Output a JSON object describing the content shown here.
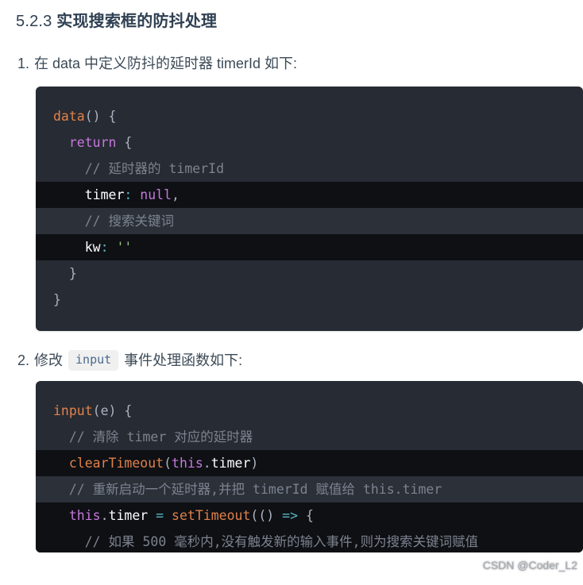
{
  "heading": {
    "number": "5.2.3",
    "title": "实现搜索框的防抖处理",
    "full": "5.2.3 实现搜索框的防抖处理"
  },
  "steps": [
    {
      "marker": "1.",
      "text_before": "在 data 中定义防抖的延时器 timerId 如下:",
      "inline_code": null,
      "text_after": null
    },
    {
      "marker": "2.",
      "text_before": "修改",
      "inline_code": "input",
      "text_after": "事件处理函数如下:"
    }
  ],
  "code_block_1": {
    "language": "javascript",
    "lines": [
      {
        "highlight": "none",
        "tokens": [
          {
            "t": "data",
            "c": "fn"
          },
          {
            "t": "() {",
            "c": "punc"
          }
        ]
      },
      {
        "highlight": "none",
        "tokens": [
          {
            "t": "  ",
            "c": "punc"
          },
          {
            "t": "return",
            "c": "kw"
          },
          {
            "t": " {",
            "c": "punc"
          }
        ]
      },
      {
        "highlight": "none",
        "tokens": [
          {
            "t": "    // 延时器的 timerId",
            "c": "comment"
          }
        ]
      },
      {
        "highlight": "dark",
        "tokens": [
          {
            "t": "    ",
            "c": "punc"
          },
          {
            "t": "timer",
            "c": "prop"
          },
          {
            "t": ":",
            "c": "colon"
          },
          {
            "t": " ",
            "c": "punc"
          },
          {
            "t": "null",
            "c": "null"
          },
          {
            "t": ",",
            "c": "punc"
          }
        ]
      },
      {
        "highlight": "slate",
        "tokens": [
          {
            "t": "    // 搜索关键词",
            "c": "comment"
          }
        ]
      },
      {
        "highlight": "dark",
        "tokens": [
          {
            "t": "    ",
            "c": "punc"
          },
          {
            "t": "kw",
            "c": "prop"
          },
          {
            "t": ":",
            "c": "colon"
          },
          {
            "t": " ",
            "c": "punc"
          },
          {
            "t": "''",
            "c": "str"
          }
        ]
      },
      {
        "highlight": "none",
        "tokens": [
          {
            "t": "  }",
            "c": "punc"
          }
        ]
      },
      {
        "highlight": "none",
        "tokens": [
          {
            "t": "}",
            "c": "punc"
          }
        ]
      }
    ]
  },
  "code_block_2": {
    "language": "javascript",
    "lines": [
      {
        "highlight": "none",
        "tokens": [
          {
            "t": "input",
            "c": "fn"
          },
          {
            "t": "(",
            "c": "punc"
          },
          {
            "t": "e",
            "c": "punc"
          },
          {
            "t": ") {",
            "c": "punc"
          }
        ]
      },
      {
        "highlight": "none",
        "tokens": [
          {
            "t": "  // 清除 timer 对应的延时器",
            "c": "comment"
          }
        ]
      },
      {
        "highlight": "dark",
        "tokens": [
          {
            "t": "  ",
            "c": "punc"
          },
          {
            "t": "clearTimeout",
            "c": "fn"
          },
          {
            "t": "(",
            "c": "punc"
          },
          {
            "t": "this",
            "c": "this"
          },
          {
            "t": ".",
            "c": "punc"
          },
          {
            "t": "timer",
            "c": "white"
          },
          {
            "t": ")",
            "c": "punc"
          }
        ]
      },
      {
        "highlight": "slate",
        "tokens": [
          {
            "t": "  // 重新启动一个延时器,并把 timerId 赋值给 this.timer",
            "c": "comment"
          }
        ]
      },
      {
        "highlight": "dark",
        "tokens": [
          {
            "t": "  ",
            "c": "punc"
          },
          {
            "t": "this",
            "c": "this"
          },
          {
            "t": ".",
            "c": "punc"
          },
          {
            "t": "timer",
            "c": "white"
          },
          {
            "t": " ",
            "c": "punc"
          },
          {
            "t": "=",
            "c": "op"
          },
          {
            "t": " ",
            "c": "punc"
          },
          {
            "t": "setTimeout",
            "c": "fn"
          },
          {
            "t": "((",
            "c": "punc"
          },
          {
            "t": ")",
            "c": "punc"
          },
          {
            "t": " ",
            "c": "punc"
          },
          {
            "t": "=>",
            "c": "arrow"
          },
          {
            "t": " {",
            "c": "punc"
          }
        ]
      },
      {
        "highlight": "dark",
        "tokens": [
          {
            "t": "    // 如果 500 毫秒内,没有触发新的输入事件,则为搜索关键词赋值",
            "c": "comment"
          }
        ]
      }
    ]
  },
  "watermark": "CSDN @Coder_L2",
  "colors": {
    "code_background": "#272b33",
    "line_highlight_dark": "#0e1014",
    "line_highlight_slate": "#2b3039",
    "heading_text": "#2f4052",
    "body_text": "#3c4a57",
    "inline_code_bg": "#f0f0f0",
    "inline_code_text": "#4a6a8a",
    "token_function": "#e0814a",
    "token_keyword": "#c678dd",
    "token_comment": "#7d838f",
    "token_string": "#98c379",
    "token_operator": "#56b6c2",
    "token_property": "#ffffff",
    "watermark_text": "#a8acb3"
  }
}
